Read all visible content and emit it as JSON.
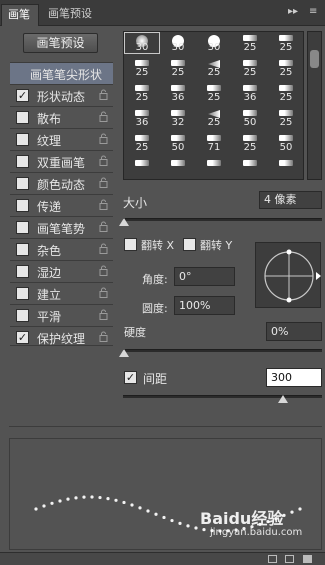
{
  "tabs": [
    {
      "label": "画笔"
    },
    {
      "label": "画笔预设"
    }
  ],
  "tab_controls": {
    "collapse": "▸▸",
    "menu": "≡"
  },
  "preset_button": "画笔预设",
  "header_option": "画笔笔尖形状",
  "options": [
    {
      "label": "形状动态",
      "checked": true
    },
    {
      "label": "散布",
      "checked": false
    },
    {
      "label": "纹理",
      "checked": false
    },
    {
      "label": "双重画笔",
      "checked": false
    },
    {
      "label": "颜色动态",
      "checked": false
    },
    {
      "label": "传递",
      "checked": false
    },
    {
      "label": "画笔笔势",
      "checked": false
    },
    {
      "label": "杂色",
      "checked": false
    },
    {
      "label": "湿边",
      "checked": false
    },
    {
      "label": "建立",
      "checked": false
    },
    {
      "label": "平滑",
      "checked": false
    },
    {
      "label": "保护纹理",
      "checked": true
    }
  ],
  "brush_tips": [
    {
      "num": "30",
      "icon": "soft-round"
    },
    {
      "num": "30",
      "icon": "hard-round"
    },
    {
      "num": "30",
      "icon": "hard-round"
    },
    {
      "num": "25",
      "icon": "brush"
    },
    {
      "num": "25",
      "icon": "brush"
    },
    {
      "num": "25",
      "icon": "brush"
    },
    {
      "num": "25",
      "icon": "brush"
    },
    {
      "num": "25",
      "icon": "fan"
    },
    {
      "num": "25",
      "icon": "brush"
    },
    {
      "num": "25",
      "icon": "brush"
    },
    {
      "num": "25",
      "icon": "brush"
    },
    {
      "num": "36",
      "icon": "brush"
    },
    {
      "num": "25",
      "icon": "brush"
    },
    {
      "num": "36",
      "icon": "brush"
    },
    {
      "num": "25",
      "icon": "brush"
    },
    {
      "num": "36",
      "icon": "brush"
    },
    {
      "num": "32",
      "icon": "brush"
    },
    {
      "num": "25",
      "icon": "fan"
    },
    {
      "num": "50",
      "icon": "brush"
    },
    {
      "num": "25",
      "icon": "brush"
    },
    {
      "num": "25",
      "icon": "brush"
    },
    {
      "num": "50",
      "icon": "brush"
    },
    {
      "num": "71",
      "icon": "brush"
    },
    {
      "num": "25",
      "icon": "brush"
    },
    {
      "num": "50",
      "icon": "brush"
    },
    {
      "num": "",
      "icon": "brush"
    },
    {
      "num": "",
      "icon": "brush"
    },
    {
      "num": "",
      "icon": "brush"
    },
    {
      "num": "",
      "icon": "brush"
    },
    {
      "num": "",
      "icon": "brush"
    }
  ],
  "size": {
    "label": "大小",
    "value": "4 像素"
  },
  "flip_x": {
    "label": "翻转 X",
    "checked": false
  },
  "flip_y": {
    "label": "翻转 Y",
    "checked": false
  },
  "angle": {
    "label": "角度:",
    "value": "0°"
  },
  "roundness": {
    "label": "圆度:",
    "value": "100%"
  },
  "hardness": {
    "label": "硬度",
    "value": "0%"
  },
  "spacing": {
    "label": "间距",
    "value": "300",
    "checked": true
  },
  "watermark": {
    "brand": "Baidu经验",
    "url": "jingyan.baidu.com"
  },
  "colors": {
    "panel": "#535353",
    "dark": "#3d3d3d",
    "selected_row": "#6c7587",
    "accent_cb": "#e7e7e7"
  }
}
